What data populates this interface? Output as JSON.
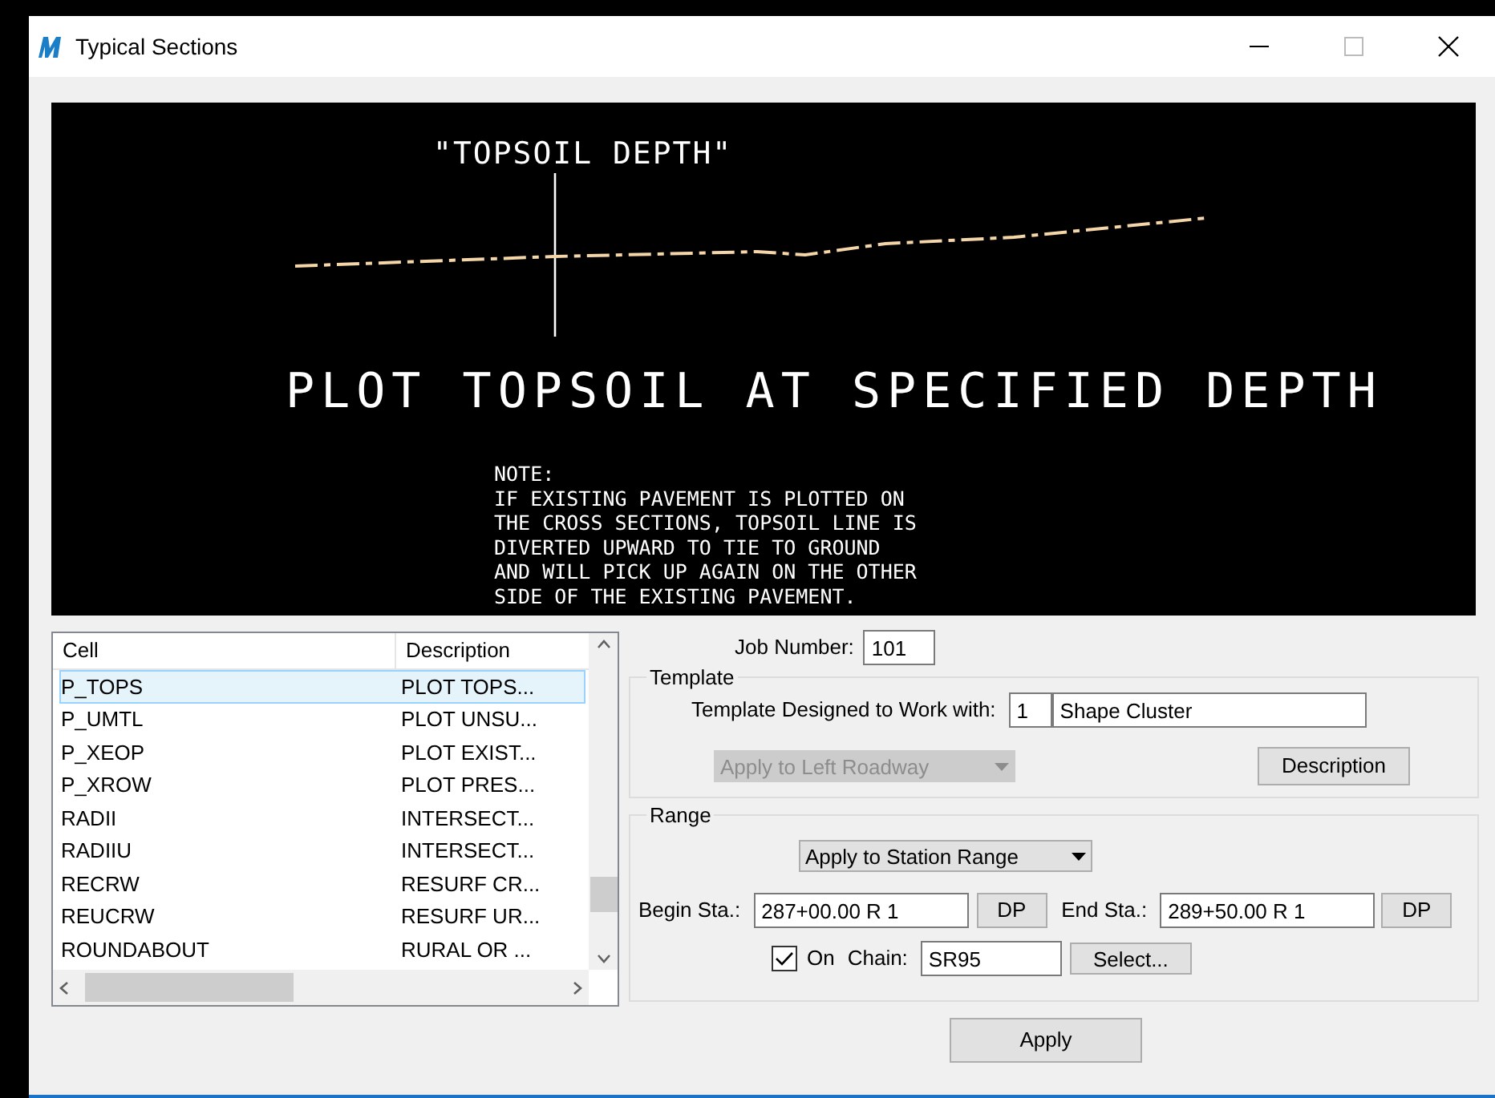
{
  "window": {
    "title": "Typical Sections"
  },
  "preview": {
    "label": "\"TOPSOIL DEPTH\"",
    "heading": "PLOT TOPSOIL AT SPECIFIED DEPTH",
    "note": [
      "NOTE:",
      "IF EXISTING PAVEMENT IS PLOTTED ON",
      "THE CROSS SECTIONS, TOPSOIL LINE IS",
      "DIVERTED UPWARD TO TIE TO GROUND",
      "AND WILL PICK UP AGAIN ON THE OTHER",
      "SIDE OF THE EXISTING PAVEMENT."
    ]
  },
  "cell_list": {
    "columns": [
      "Cell",
      "Description"
    ],
    "rows": [
      {
        "cell": "P_TOPS",
        "description": "PLOT TOPS...",
        "selected": true
      },
      {
        "cell": "P_UMTL",
        "description": "PLOT UNSU...",
        "selected": false
      },
      {
        "cell": "P_XEOP",
        "description": "PLOT EXIST...",
        "selected": false
      },
      {
        "cell": "P_XROW",
        "description": "PLOT PRES...",
        "selected": false
      },
      {
        "cell": "RADII",
        "description": "INTERSECT...",
        "selected": false
      },
      {
        "cell": "RADIIU",
        "description": "INTERSECT...",
        "selected": false
      },
      {
        "cell": "RECRW",
        "description": "RESURF CR...",
        "selected": false
      },
      {
        "cell": "REUCRW",
        "description": "RESURF UR...",
        "selected": false
      },
      {
        "cell": "ROUNDABOUT",
        "description": "RURAL OR  ...",
        "selected": false
      }
    ]
  },
  "job_number": {
    "label": "Job Number:",
    "value": "101"
  },
  "template": {
    "title": "Template",
    "designed_label": "Template Designed to Work with:",
    "designed_number": "1",
    "designed_name": "Shape Cluster",
    "roadway_dropdown": {
      "value": "Apply to Left Roadway",
      "disabled": true
    },
    "description_button": "Description"
  },
  "range": {
    "title": "Range",
    "range_dropdown": {
      "value": "Apply to Station Range",
      "disabled": false
    },
    "begin_label": "Begin Sta.:",
    "begin_value": "287+00.00 R 1",
    "begin_button": "DP",
    "end_label": "End Sta.:",
    "end_value": "289+50.00 R 1",
    "end_button": "DP",
    "on_chain": {
      "label": "On",
      "checked": true
    },
    "chain_label": "Chain:",
    "chain_value": "SR95",
    "select_button": "Select..."
  },
  "apply_button": "Apply"
}
